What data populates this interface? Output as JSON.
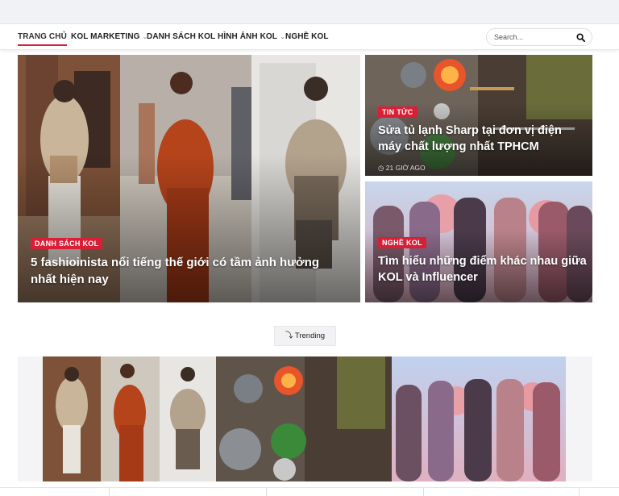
{
  "nav": {
    "items": [
      {
        "label": "TRANG CHỦ",
        "active": true
      },
      {
        "label": "KOL MARKETING",
        "dropdown": true
      },
      {
        "label": "DANH SÁCH KOL"
      },
      {
        "label": "HÌNH ẢNH KOL",
        "dropdown": true
      },
      {
        "label": "NGHỀ KOL"
      }
    ],
    "search_placeholder": "Search..."
  },
  "hero": {
    "main": {
      "badge": "DANH SÁCH KOL",
      "title": "5 fashioinista nổi tiếng thế giới có tầm ảnh hưởng nhất hiện nay"
    },
    "side_top": {
      "badge": "TIN TỨC",
      "title": "Sửa tủ lạnh Sharp tại đơn vị điện máy chất lượng nhất TPHCM",
      "time": "21 GIỜ AGO"
    },
    "side_bottom": {
      "badge": "NGHỀ KOL",
      "title": "Tìm hiểu những điểm khác nhau giữa KOL và Influencer"
    }
  },
  "trending": {
    "label": "Trending"
  },
  "colors": {
    "accent": "#d81f36"
  }
}
